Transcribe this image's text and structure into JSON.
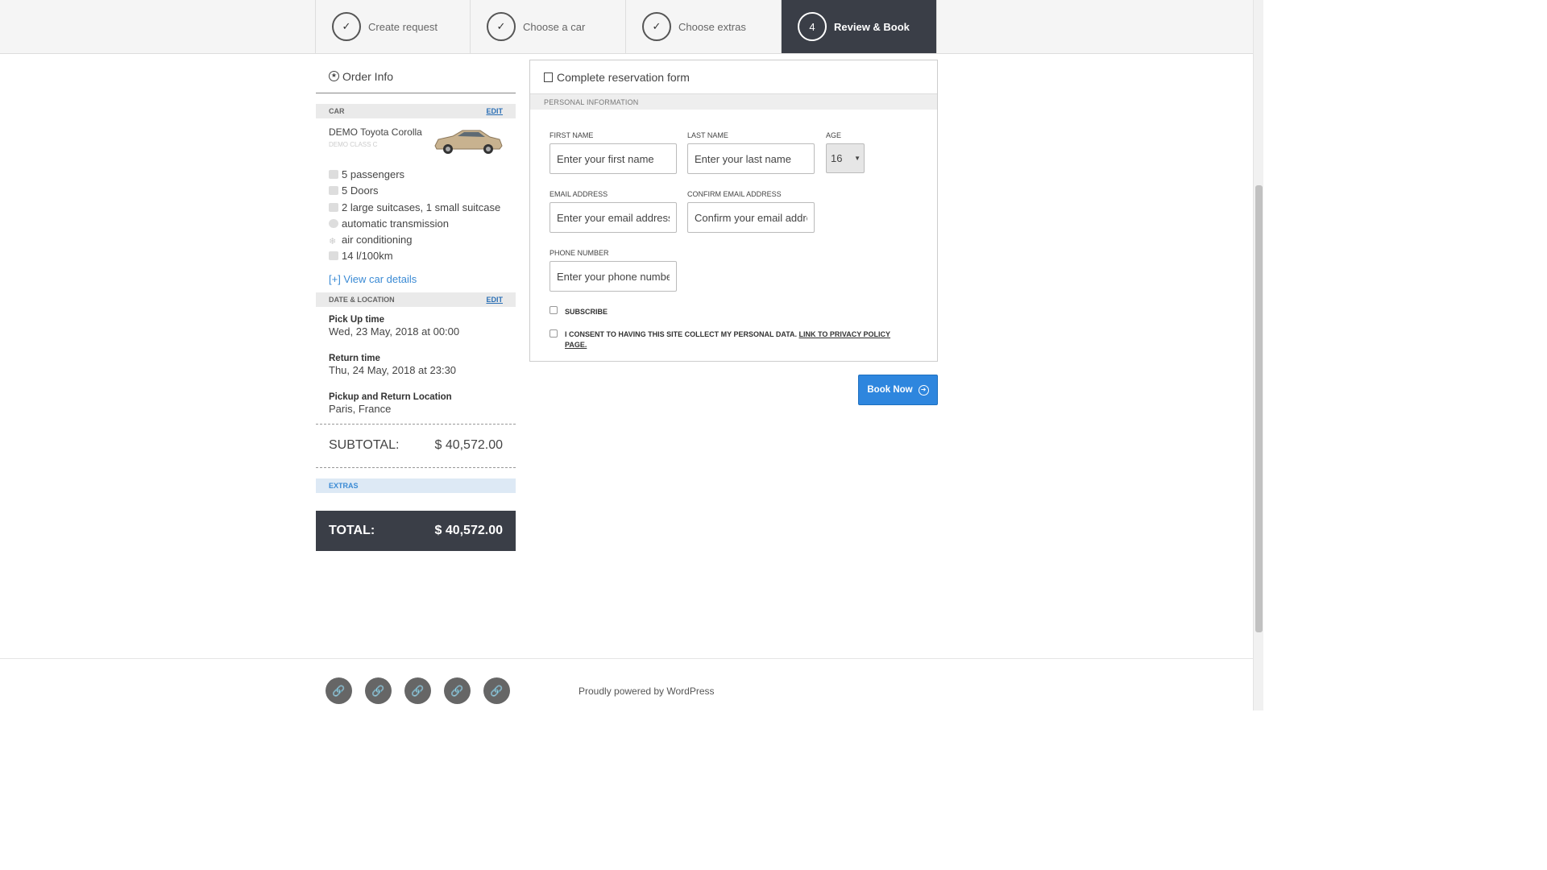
{
  "steps": [
    {
      "marker": "✓",
      "label": "Create request"
    },
    {
      "marker": "✓",
      "label": "Choose a car"
    },
    {
      "marker": "✓",
      "label": "Choose extras"
    },
    {
      "marker": "4",
      "label": "Review & Book"
    }
  ],
  "sidebar": {
    "title": "Order Info",
    "car_section": {
      "label": "CAR",
      "edit": "EDIT"
    },
    "car": {
      "name": "DEMO Toyota Corolla",
      "class": "DEMO CLASS C"
    },
    "features": [
      {
        "icon": "passengers-icon",
        "text": "5 passengers"
      },
      {
        "icon": "doors-icon",
        "text": "5 Doors"
      },
      {
        "icon": "suitcase-icon",
        "text": "2 large suitcases, 1 small suitcase"
      },
      {
        "icon": "transmission-icon",
        "text": "automatic transmission"
      },
      {
        "icon": "snowflake-icon",
        "text": "air conditioning"
      },
      {
        "icon": "fuel-icon",
        "text": "14 l/100km"
      }
    ],
    "view_details": "[+] View car details",
    "date_section": {
      "label": "DATE & LOCATION",
      "edit": "EDIT"
    },
    "pickup": {
      "label": "Pick Up time",
      "value": "Wed, 23 May, 2018 at 00:00"
    },
    "return": {
      "label": "Return time",
      "value": "Thu, 24 May, 2018 at 23:30"
    },
    "location": {
      "label": "Pickup and Return Location",
      "value": "Paris, France"
    },
    "subtotal": {
      "label": "SUBTOTAL:",
      "value": "$ 40,572.00"
    },
    "extras_label": "EXTRAS",
    "total": {
      "label": "TOTAL:",
      "value": "$ 40,572.00"
    }
  },
  "form": {
    "title": "Complete reservation form",
    "section": "PERSONAL INFORMATION",
    "first_name": {
      "label": "FIRST NAME",
      "placeholder": "Enter your first name"
    },
    "last_name": {
      "label": "LAST NAME",
      "placeholder": "Enter your last name"
    },
    "age": {
      "label": "AGE",
      "value": "16"
    },
    "email": {
      "label": "EMAIL ADDRESS",
      "placeholder": "Enter your email address"
    },
    "confirm_email": {
      "label": "CONFIRM EMAIL ADDRESS",
      "placeholder": "Confirm your email address"
    },
    "phone": {
      "label": "PHONE NUMBER",
      "placeholder": "Enter your phone number"
    },
    "subscribe": "SUBSCRIBE",
    "consent": "I CONSENT TO HAVING THIS SITE COLLECT MY PERSONAL DATA.",
    "privacy_link": "LINK TO PRIVACY POLICY PAGE.",
    "book_now": "Book Now"
  },
  "footer": {
    "social_icons": [
      "link-icon",
      "link-icon",
      "link-icon",
      "link-icon",
      "link-icon"
    ],
    "powered": "Proudly powered by WordPress"
  },
  "colors": {
    "accent": "#2e86de",
    "dark": "#3a3e47",
    "link": "#3a8ad4"
  }
}
